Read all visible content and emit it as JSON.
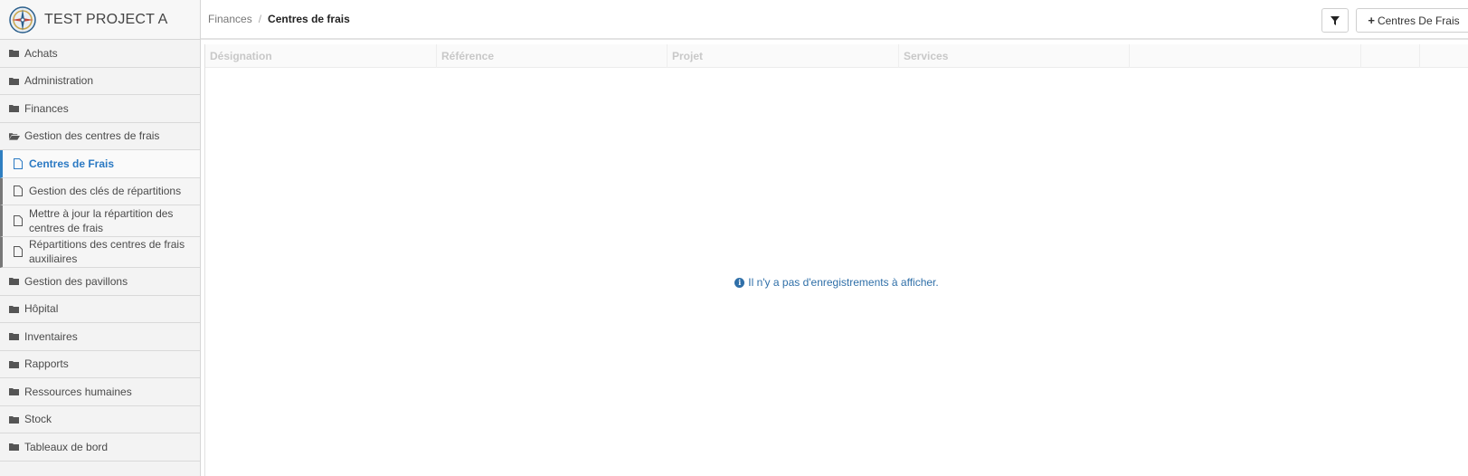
{
  "app": {
    "title": "TEST PROJECT A"
  },
  "sidebar": {
    "items": [
      {
        "label": "Achats",
        "icon": "folder-icon"
      },
      {
        "label": "Administration",
        "icon": "folder-icon"
      },
      {
        "label": "Finances",
        "icon": "folder-icon"
      },
      {
        "label": "Gestion des centres de frais",
        "icon": "folder-open-icon"
      },
      {
        "label": "Centres de Frais",
        "icon": "file-icon",
        "active": true
      },
      {
        "label": "Gestion des clés de répartitions",
        "icon": "file-icon"
      },
      {
        "label": "Mettre à jour la répartition des centres de frais",
        "icon": "file-icon"
      },
      {
        "label": "Répartitions des centres de frais auxiliaires",
        "icon": "file-icon"
      },
      {
        "label": "Gestion des pavillons",
        "icon": "folder-icon"
      },
      {
        "label": "Hôpital",
        "icon": "folder-icon"
      },
      {
        "label": "Inventaires",
        "icon": "folder-icon"
      },
      {
        "label": "Rapports",
        "icon": "folder-icon"
      },
      {
        "label": "Ressources humaines",
        "icon": "folder-icon"
      },
      {
        "label": "Stock",
        "icon": "folder-icon"
      },
      {
        "label": "Tableaux de bord",
        "icon": "folder-icon"
      }
    ]
  },
  "header": {
    "breadcrumb": {
      "parent": "Finances",
      "separator": "/",
      "current": "Centres de frais"
    },
    "filter_icon": "filter-icon",
    "add_button_label": "Centres De Frais"
  },
  "grid": {
    "columns": [
      "Désignation",
      "Référence",
      "Projet",
      "Services",
      "",
      ""
    ],
    "empty_message": "Il n'y a pas d'enregistrements à afficher."
  },
  "colors": {
    "accent": "#2a79c3",
    "info": "#2f6fa8"
  }
}
